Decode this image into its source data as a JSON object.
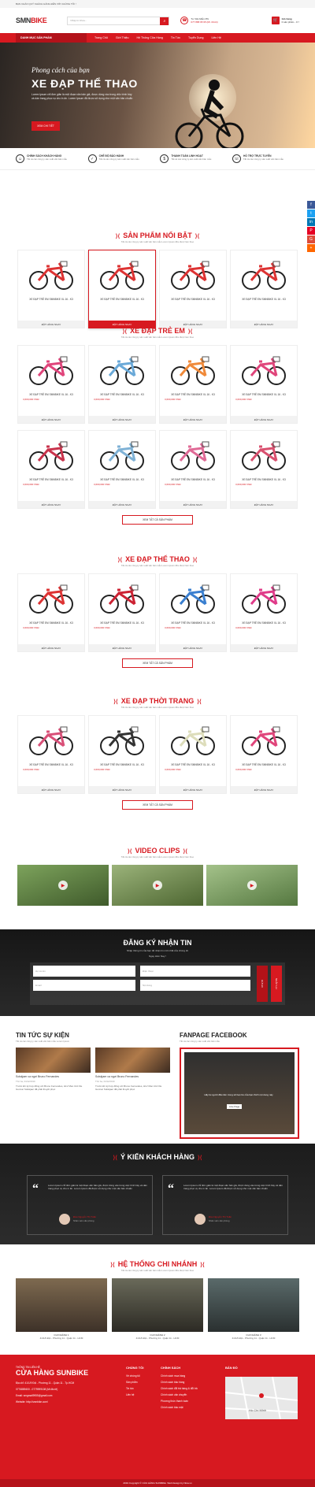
{
  "topbar": {
    "welcome": "BẠN CHÀO QUÝ KHÁCH HÀNG ĐẾN VỚI CHÚNG TÔI !"
  },
  "header": {
    "logo_a": "SMN",
    "logo_b": "BIKE",
    "search_placeholder": "Nhập từ khóa...",
    "hotline_label": "Tư Vấn Miễn Phí",
    "hotline": "077 888 95 95 (Mr. Mười)",
    "cart_label": "Giỏ hàng",
    "cart_count": "0 sản phẩm - 0 ₫"
  },
  "nav": {
    "category": "DANH MỤC SẢN PHẨM",
    "items": [
      "Trang Chủ",
      "Giới Thiệu",
      "Hệ Thống Cửa Hàng",
      "Tin Tức",
      "Tuyển Dụng",
      "Liên Hệ"
    ]
  },
  "hero": {
    "script": "Phong cách của bạn",
    "title": "XE ĐẠP THỂ THAO",
    "desc": "Lorem Ipsum chỉ đơn giản là một đoạn văn bản giả, được dùng vào trong việc trình bày và dàn trang phục vụ cho in ấn. Lorem Ipsum đã được sử dụng như một văn bản chuẩn",
    "button": "XEM CHI TIẾT"
  },
  "policies": [
    {
      "title": "CHÍNH SÁCH KHÁCH HÀNG",
      "desc": "Tất cả các công ty sản xuất văn bản mẫu"
    },
    {
      "title": "CHẾ ĐỘ BẢO HÀNH",
      "desc": "Tất cả các công ty sản xuất văn bản mẫu"
    },
    {
      "title": "THANH TOÁN LINH HOẠT",
      "desc": "Tất cả các công ty sản xuất văn bản mẫu"
    },
    {
      "title": "HỖ TRỢ TRỰC TUYẾN",
      "desc": "Tất cả các công ty sản xuất văn bản mẫu"
    }
  ],
  "sections": {
    "featured": {
      "title": "SẢN PHẨM NỔI BẬT",
      "sub": "Tất cả các công ty sản xuất văn bản mẫu Lorem Ipsum đều được làm theo"
    },
    "kids": {
      "title": "XE ĐẠP TRẺ EM",
      "sub": "Tất cả các công ty sản xuất văn bản mẫu Lorem Ipsum đều được làm theo"
    },
    "sport": {
      "title": "XE ĐẠP THỂ THAO",
      "sub": "Tất cả các công ty sản xuất văn bản mẫu Lorem Ipsum đều được làm theo"
    },
    "fashion": {
      "title": "XE ĐẠP THỜI TRANG",
      "sub": "Tất cả các công ty sản xuất văn bản mẫu Lorem Ipsum đều được làm theo"
    },
    "video": {
      "title": "VIDEO CLIPS",
      "sub": "Tất cả các công ty sản xuất văn bản mẫu Lorem Ipsum đều được làm theo"
    }
  },
  "product": {
    "name": "XE ĐẠP TRẺ EM SMNBIKE XL 16 - K3",
    "price": "3,600,000 VNĐ",
    "buy": "ĐẶT HÀNG NGAY"
  },
  "more_label": "XEM TẤT CẢ SẢN PHẨM",
  "newsletter": {
    "title": "ĐĂNG KÝ NHẬN TIN",
    "desc": "Nhập thông tin của bạn để nhận tin mới nhất của chúng tôi",
    "desc2": "Ngay Hôm Nay !",
    "fields": [
      "Họ và tên",
      "Điện thoại",
      "Email",
      "Nội dung"
    ],
    "send": "GỬI ĐI",
    "reset": "NHẬP LẠI"
  },
  "news": {
    "title": "TIN TỨC SỰ KIỆN",
    "sub": "Tất cả các công ty sản xuất văn bản mẫu Lorem Ipsum",
    "items": [
      {
        "title": "Solskjaer ca ngợi Bruno Fernandes",
        "date": "Thứ ba, 04/12/2019",
        "desc": "Trước khi ký hợp đồng với Bruno Fernandes, HLV Man Utd Ole Gunnar Solskjaer đã phải thuyết phục"
      },
      {
        "title": "Solskjaer ca ngợi Bruno Fernandes",
        "date": "Thứ ba, 04/12/2019",
        "desc": "Trước khi ký hợp đồng với Bruno Fernandes, HLV Man Utd Ole Gunnar Solskjaer đã phải thuyết phục"
      }
    ]
  },
  "fanpage": {
    "title": "FANPAGE FACEBOOK",
    "sub": "Tất cả các công ty sản xuất văn bản mẫu",
    "like_text": "Hãy là người đầu tiên trong số bạn bè của bạn thích nội dung này",
    "like_btn": "Like Page"
  },
  "testimonials": {
    "title": "Ý KIẾN KHÁCH HÀNG",
    "items": [
      {
        "text": "Lorem Ipsum chỉ đơn giản là một đoạn văn bản giả, được dùng vào trong việc trình bày và dàn trang phục vụ cho in ấn. Lorem Ipsum đã được sử dụng như một văn bản chuẩn",
        "name": "Đào Nguyễn Thị Tuấn",
        "role": "Nhân viên văn phòng"
      },
      {
        "text": "Lorem Ipsum chỉ đơn giản là một đoạn văn bản giả, được dùng vào trong việc trình bày và dàn trang phục vụ cho in ấn. Lorem Ipsum đã được sử dụng như một văn bản chuẩn",
        "name": "Đào Nguyễn Thị Tuấn",
        "role": "Nhân viên văn phòng"
      }
    ]
  },
  "branches": {
    "title": "HỆ THỐNG CHI NHÁNH",
    "sub": "Tất cả các công ty sản xuất văn bản mẫu Lorem Ipsum đều được làm theo",
    "items": [
      {
        "name": "CHI NHÁNH 1",
        "addr": "41/1/9 Đội - Phường 11 - Quận 11 - HCM"
      },
      {
        "name": "CHI NHÁNH 2",
        "addr": "41/1/9 Đội - Phường 11 - Quận 11 - HCM"
      },
      {
        "name": "CHI NHÁNH 3",
        "addr": "41/1/9 Đội - Phường 11 - Quận 11 - HCM"
      }
    ]
  },
  "footer": {
    "kicker": "THÔNG TIN LIÊN HỆ",
    "store": "CỬA HÀNG SUNBIKE",
    "contact": [
      "Địa chỉ: 41/1/9 Đội - Phường 11 - Quận 11 - Tp.HCM",
      "0776889400 - 0779999108 (Mr.Mười)",
      "Email: smgmail9955@gmail.com",
      "Website: http://smnbike.com/"
    ],
    "col2_title": "CHÚNG TÔI",
    "col2": [
      "Về chúng tôi",
      "Sản phẩm",
      "Tin tức",
      "Liên hệ"
    ],
    "col3_title": "CHÍNH SÁCH",
    "col3": [
      "Chính sách mua hàng",
      "Chính sách bảo hàng",
      "Chính sách đổi trả hàng & đổi trả",
      "Chính sách vận chuyển",
      "Phương thức thanh toán",
      "Chính sách bảo mật"
    ],
    "map_title": "BẢN ĐỒ",
    "map_city": "Hồ Chí Minh",
    "copyright": "2019 Copyright © CỬA HÀNG SUNBIKE. Web Design by Nina.vn"
  }
}
